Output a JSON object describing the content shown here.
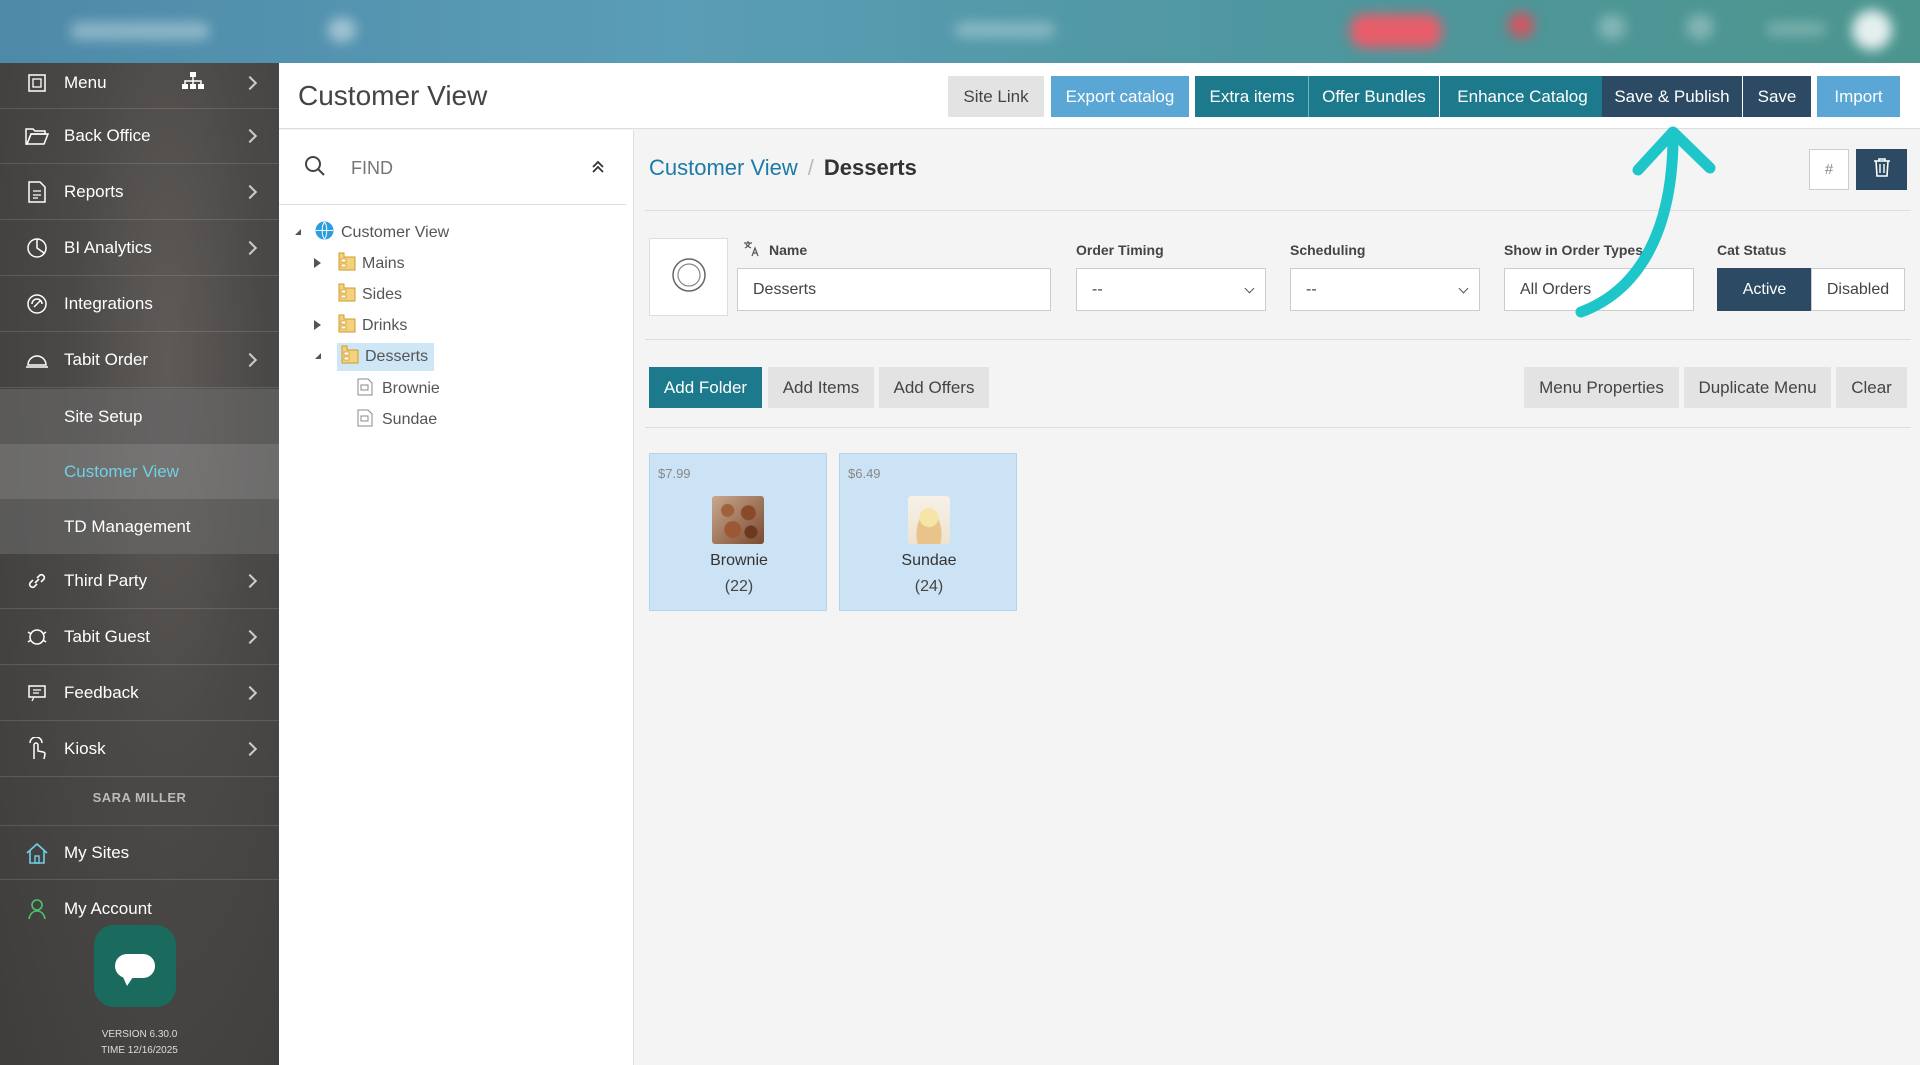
{
  "sidebar": {
    "items": [
      {
        "label": "Menu"
      },
      {
        "label": "Back Office"
      },
      {
        "label": "Reports"
      },
      {
        "label": "BI Analytics"
      },
      {
        "label": "Integrations"
      },
      {
        "label": "Tabit Order"
      },
      {
        "label": "Third Party"
      },
      {
        "label": "Tabit Guest"
      },
      {
        "label": "Feedback"
      },
      {
        "label": "Kiosk"
      },
      {
        "label": "My Sites"
      },
      {
        "label": "My Account"
      }
    ],
    "sub_items": [
      {
        "label": "Site Setup"
      },
      {
        "label": "Customer View"
      },
      {
        "label": "TD Management"
      }
    ],
    "user_name": "SARA MILLER",
    "version": "VERSION 6.30.0",
    "time": "TIME 12/16/2025"
  },
  "header": {
    "title": "Customer View",
    "buttons": {
      "site_link": "Site Link",
      "export_catalog": "Export catalog",
      "extra_items": "Extra items",
      "offer_bundles": "Offer Bundles",
      "enhance_catalog": "Enhance Catalog",
      "save_publish": "Save & Publish",
      "save": "Save",
      "import": "Import"
    }
  },
  "tree": {
    "search_placeholder": "FIND",
    "root": "Customer View",
    "nodes": [
      {
        "label": "Mains"
      },
      {
        "label": "Sides"
      },
      {
        "label": "Drinks"
      },
      {
        "label": "Desserts"
      }
    ],
    "children": [
      {
        "label": "Brownie"
      },
      {
        "label": "Sundae"
      }
    ]
  },
  "content": {
    "breadcrumb": {
      "root": "Customer View",
      "current": "Desserts"
    },
    "hash_label": "#",
    "form": {
      "name_label": "Name",
      "name_value": "Desserts",
      "order_timing_label": "Order Timing",
      "order_timing_value": "--",
      "scheduling_label": "Scheduling",
      "scheduling_value": "--",
      "order_types_label": "Show in Order Types",
      "order_types_value": "All Orders",
      "cat_status_label": "Cat Status",
      "status_active": "Active",
      "status_disabled": "Disabled"
    },
    "actions": {
      "add_folder": "Add Folder",
      "add_items": "Add Items",
      "add_offers": "Add Offers",
      "menu_properties": "Menu Properties",
      "duplicate_menu": "Duplicate Menu",
      "clear": "Clear"
    },
    "items": [
      {
        "price": "$7.99",
        "name": "Brownie",
        "count": "(22)"
      },
      {
        "price": "$6.49",
        "name": "Sundae",
        "count": "(24)"
      }
    ]
  },
  "colors": {
    "accent_teal": "#1d7a8c",
    "navy": "#2c4a63",
    "light_blue": "#5aa6d4",
    "arrow": "#1ec6c9"
  }
}
